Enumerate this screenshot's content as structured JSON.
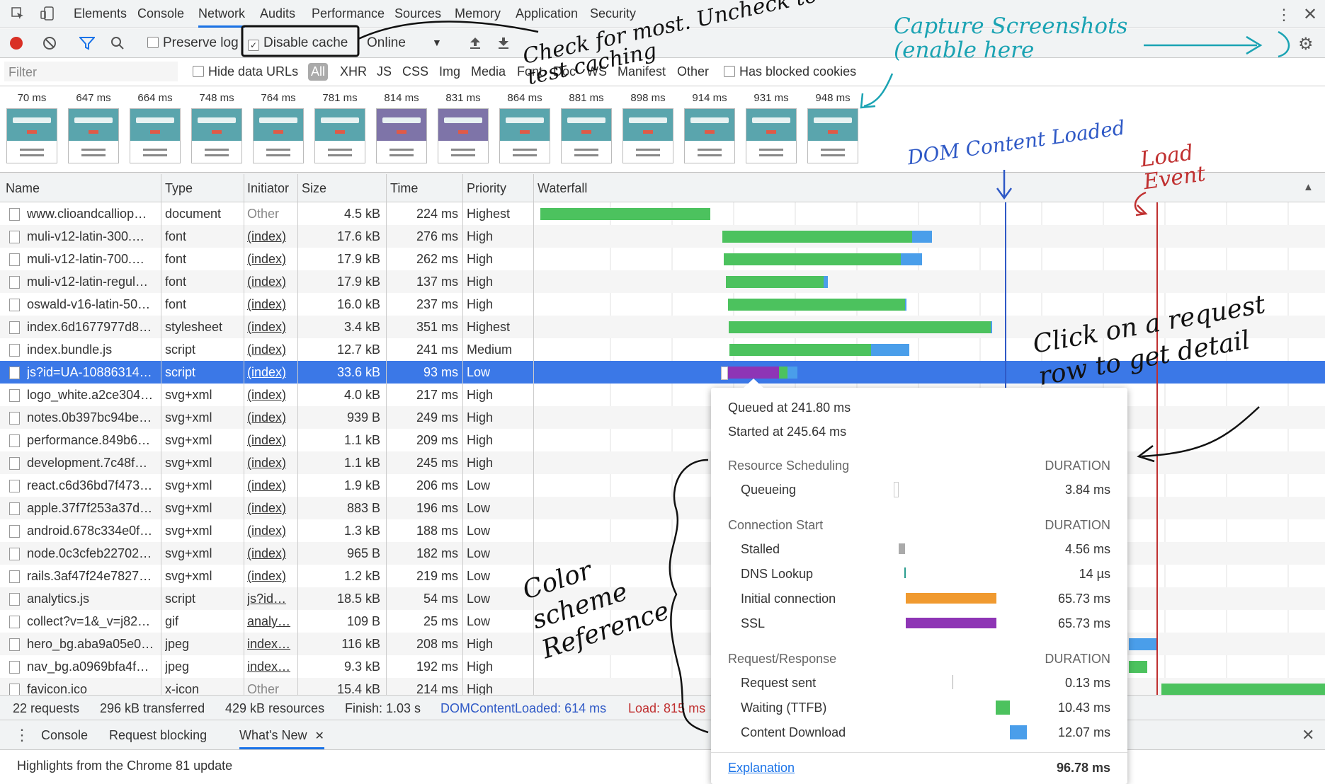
{
  "devtools_tabs": [
    "Elements",
    "Console",
    "Network",
    "Audits",
    "Performance",
    "Sources",
    "Memory",
    "Application",
    "Security"
  ],
  "toolbar": {
    "preserve_log": "Preserve log",
    "disable_cache": "Disable cache",
    "throttle": "Online"
  },
  "filter": {
    "placeholder": "Filter",
    "hide_data_urls": "Hide data URLs",
    "types": [
      "All",
      "XHR",
      "JS",
      "CSS",
      "Img",
      "Media",
      "Font",
      "Doc",
      "WS",
      "Manifest",
      "Other"
    ],
    "has_blocked_cookies": "Has blocked cookies"
  },
  "filmstrip": [
    "70 ms",
    "647 ms",
    "664 ms",
    "748 ms",
    "764 ms",
    "781 ms",
    "814 ms",
    "831 ms",
    "864 ms",
    "881 ms",
    "898 ms",
    "914 ms",
    "931 ms",
    "948 ms"
  ],
  "columns": [
    "Name",
    "Type",
    "Initiator",
    "Size",
    "Time",
    "Priority",
    "Waterfall"
  ],
  "rows": [
    {
      "name": "www.clioandcalliop…",
      "type": "document",
      "initiator": "Other",
      "size": "4.5 kB",
      "time": "224 ms",
      "priority": "Highest"
    },
    {
      "name": "muli-v12-latin-300.…",
      "type": "font",
      "initiator": "(index)",
      "size": "17.6 kB",
      "time": "276 ms",
      "priority": "High"
    },
    {
      "name": "muli-v12-latin-700.…",
      "type": "font",
      "initiator": "(index)",
      "size": "17.9 kB",
      "time": "262 ms",
      "priority": "High"
    },
    {
      "name": "muli-v12-latin-regul…",
      "type": "font",
      "initiator": "(index)",
      "size": "17.9 kB",
      "time": "137 ms",
      "priority": "High"
    },
    {
      "name": "oswald-v16-latin-50…",
      "type": "font",
      "initiator": "(index)",
      "size": "16.0 kB",
      "time": "237 ms",
      "priority": "High"
    },
    {
      "name": "index.6d1677977d8…",
      "type": "stylesheet",
      "initiator": "(index)",
      "size": "3.4 kB",
      "time": "351 ms",
      "priority": "Highest"
    },
    {
      "name": "index.bundle.js",
      "type": "script",
      "initiator": "(index)",
      "size": "12.7 kB",
      "time": "241 ms",
      "priority": "Medium"
    },
    {
      "name": "js?id=UA-10886314…",
      "type": "script",
      "initiator": "(index)",
      "size": "33.6 kB",
      "time": "93 ms",
      "priority": "Low"
    },
    {
      "name": "logo_white.a2ce304…",
      "type": "svg+xml",
      "initiator": "(index)",
      "size": "4.0 kB",
      "time": "217 ms",
      "priority": "High"
    },
    {
      "name": "notes.0b397bc94be…",
      "type": "svg+xml",
      "initiator": "(index)",
      "size": "939 B",
      "time": "249 ms",
      "priority": "High"
    },
    {
      "name": "performance.849b6…",
      "type": "svg+xml",
      "initiator": "(index)",
      "size": "1.1 kB",
      "time": "209 ms",
      "priority": "High"
    },
    {
      "name": "development.7c48f…",
      "type": "svg+xml",
      "initiator": "(index)",
      "size": "1.1 kB",
      "time": "245 ms",
      "priority": "High"
    },
    {
      "name": "react.c6d36bd7f473…",
      "type": "svg+xml",
      "initiator": "(index)",
      "size": "1.9 kB",
      "time": "206 ms",
      "priority": "Low"
    },
    {
      "name": "apple.37f7f253a37d…",
      "type": "svg+xml",
      "initiator": "(index)",
      "size": "883 B",
      "time": "196 ms",
      "priority": "Low"
    },
    {
      "name": "android.678c334e0f…",
      "type": "svg+xml",
      "initiator": "(index)",
      "size": "1.3 kB",
      "time": "188 ms",
      "priority": "Low"
    },
    {
      "name": "node.0c3cfeb22702…",
      "type": "svg+xml",
      "initiator": "(index)",
      "size": "965 B",
      "time": "182 ms",
      "priority": "Low"
    },
    {
      "name": "rails.3af47f24e7827…",
      "type": "svg+xml",
      "initiator": "(index)",
      "size": "1.2 kB",
      "time": "219 ms",
      "priority": "Low"
    },
    {
      "name": "analytics.js",
      "type": "script",
      "initiator": "js?id…",
      "size": "18.5 kB",
      "time": "54 ms",
      "priority": "Low"
    },
    {
      "name": "collect?v=1&_v=j82…",
      "type": "gif",
      "initiator": "analy…",
      "size": "109 B",
      "time": "25 ms",
      "priority": "Low"
    },
    {
      "name": "hero_bg.aba9a05e0…",
      "type": "jpeg",
      "initiator": "index…",
      "size": "116 kB",
      "time": "208 ms",
      "priority": "High"
    },
    {
      "name": "nav_bg.a0969bfa4f…",
      "type": "jpeg",
      "initiator": "index…",
      "size": "9.3 kB",
      "time": "192 ms",
      "priority": "High"
    },
    {
      "name": "favicon.ico",
      "type": "x-icon",
      "initiator": "Other",
      "size": "15.4 kB",
      "time": "214 ms",
      "priority": "High"
    }
  ],
  "status": {
    "requests": "22 requests",
    "transferred": "296 kB transferred",
    "resources": "429 kB resources",
    "finish": "Finish: 1.03 s",
    "dcl": "DOMContentLoaded: 614 ms",
    "load": "Load: 815 ms"
  },
  "drawer": {
    "tabs": [
      "Console",
      "Request blocking",
      "What's New"
    ],
    "content": "Highlights from the Chrome 81 update"
  },
  "timing": {
    "queued": "Queued at 241.80 ms",
    "started": "Started at 245.64 ms",
    "duration_label": "DURATION",
    "resource_scheduling": "Resource Scheduling",
    "queueing": {
      "label": "Queueing",
      "value": "3.84 ms"
    },
    "connection_start": "Connection Start",
    "stalled": {
      "label": "Stalled",
      "value": "4.56 ms"
    },
    "dns": {
      "label": "DNS Lookup",
      "value": "14 µs"
    },
    "initial": {
      "label": "Initial connection",
      "value": "65.73 ms"
    },
    "ssl": {
      "label": "SSL",
      "value": "65.73 ms"
    },
    "request_response": "Request/Response",
    "sent": {
      "label": "Request sent",
      "value": "0.13 ms"
    },
    "waiting": {
      "label": "Waiting (TTFB)",
      "value": "10.43 ms"
    },
    "download": {
      "label": "Content Download",
      "value": "12.07 ms"
    },
    "explanation": "Explanation",
    "total": "96.78 ms"
  },
  "annotations": {
    "disable_cache_note": "Check for most. Uncheck to test caching",
    "capture_note": "Capture Screenshots (enable here",
    "dcl_note": "DOM Content Loaded",
    "load_note": "Load Event",
    "click_note": "Click on a request row to get detail",
    "color_note": "Color scheme Reference"
  },
  "colors": {
    "accent": "#1a73e8",
    "selected_row": "#3b78e7",
    "waiting_green": "#4cc25e",
    "download_blue": "#4a9eea",
    "ssl_purple": "#8e35b5",
    "connect_orange": "#f09a30",
    "dcl_line": "#2f59c6",
    "load_line": "#c03030",
    "annotation_teal": "#1aa3b3"
  }
}
